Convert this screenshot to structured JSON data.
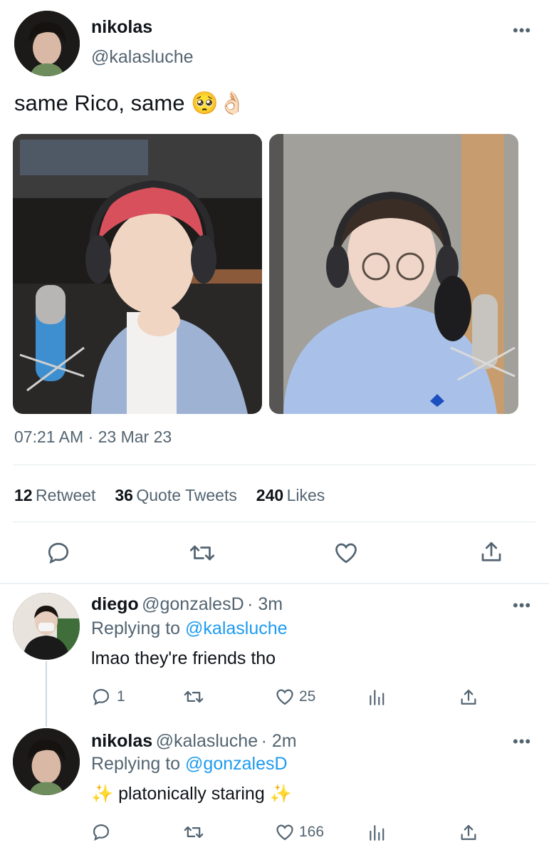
{
  "main_tweet": {
    "display_name": "nikolas",
    "handle": "@kalasluche",
    "text": "same Rico, same",
    "emoji": "🥺👌🏻",
    "timestamp": "07:21 AM · 23 Mar 23",
    "stats": {
      "retweets_count": "12",
      "retweets_label": "Retweet",
      "quotes_count": "36",
      "quotes_label": "Quote Tweets",
      "likes_count": "240",
      "likes_label": "Likes"
    },
    "more_icon": "ellipsis-icon"
  },
  "replies": [
    {
      "display_name": "diego",
      "handle": "@gonzalesD",
      "time": "· 3m",
      "replying_prefix": "Replying to",
      "replying_to": "@kalasluche",
      "text": "lmao they're friends tho",
      "reply_count": "1",
      "retweet_count": "",
      "like_count": "25"
    },
    {
      "display_name": "nikolas",
      "handle": "@kalasluche",
      "time": "· 2m",
      "replying_prefix": "Replying to",
      "replying_to": "@gonzalesD",
      "text": "✨ platonically staring ✨",
      "reply_count": "",
      "retweet_count": "",
      "like_count": "166"
    }
  ],
  "colors": {
    "accent": "#1d9bf0",
    "secondary_text": "#536471",
    "divider": "#e6ebee"
  }
}
